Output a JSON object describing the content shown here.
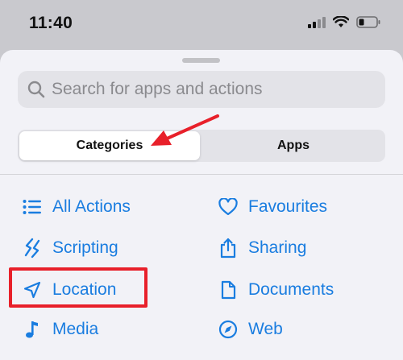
{
  "status_bar": {
    "time": "11:40"
  },
  "search": {
    "placeholder": "Search for apps and actions"
  },
  "segments": {
    "categories": "Categories",
    "apps": "Apps"
  },
  "actions_left": [
    {
      "label": "All Actions",
      "icon": "list-icon"
    },
    {
      "label": "Scripting",
      "icon": "scripting-icon"
    },
    {
      "label": "Location",
      "icon": "location-arrow-icon"
    },
    {
      "label": "Media",
      "icon": "music-note-icon"
    }
  ],
  "actions_right": [
    {
      "label": "Favourites",
      "icon": "heart-icon"
    },
    {
      "label": "Sharing",
      "icon": "share-icon"
    },
    {
      "label": "Documents",
      "icon": "document-icon"
    },
    {
      "label": "Web",
      "icon": "compass-icon"
    }
  ],
  "colors": {
    "accent": "#1a7de0",
    "annotation": "#e8202a"
  }
}
